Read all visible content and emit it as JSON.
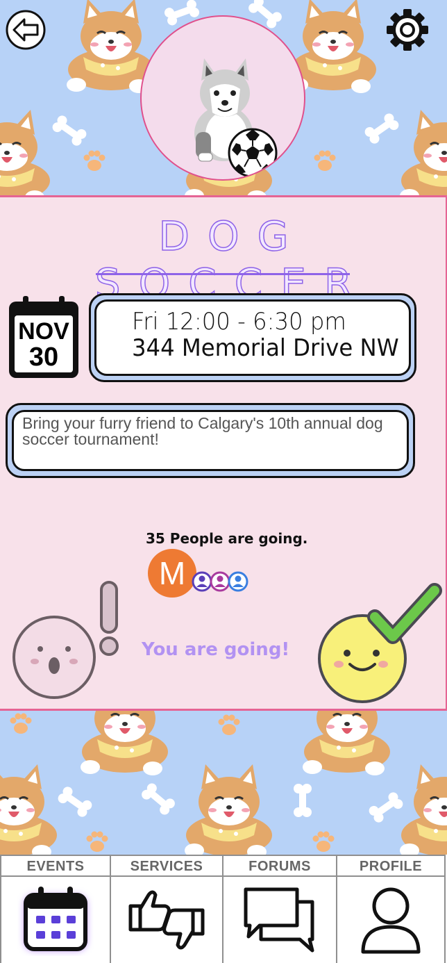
{
  "event": {
    "title": "DOG SOCCER",
    "month": "NOV",
    "day": "30",
    "time": "Fri 12:00 - 6:30 pm",
    "address": "344 Memorial Drive NW",
    "description": "Bring your furry friend to Calgary's 10th annual dog soccer tournament!"
  },
  "attendance": {
    "count_text": "35 People are going.",
    "avatar_initial": "M",
    "status_text": "You are going!"
  },
  "nav": {
    "items": [
      {
        "label": "EVENTS",
        "icon": "calendar-icon",
        "active": true
      },
      {
        "label": "SERVICES",
        "icon": "thumbs-icon",
        "active": false
      },
      {
        "label": "FORUMS",
        "icon": "chat-bubbles-icon",
        "active": false
      },
      {
        "label": "PROFILE",
        "icon": "user-icon",
        "active": false
      }
    ]
  },
  "colors": {
    "panel_bg": "#f8e1ea",
    "panel_border": "#e56494",
    "accent_purple": "#8e63e8",
    "box_blue": "#bcd1f4",
    "pattern_bg": "#b7d2f7",
    "avatar_orange": "#ee7a33",
    "status_purple": "#b292f2"
  }
}
